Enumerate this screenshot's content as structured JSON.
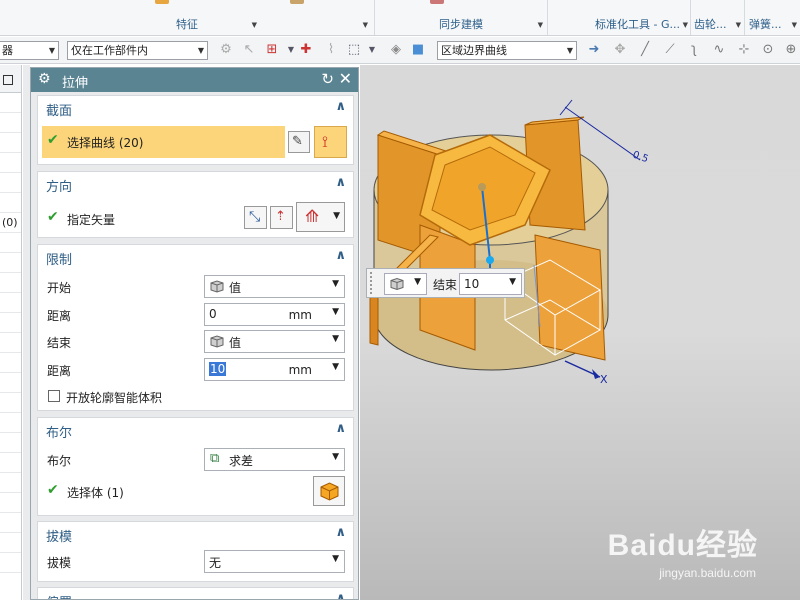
{
  "ribbon": {
    "groups": [
      {
        "label": "特征"
      },
      {
        "label": "同步建模"
      },
      {
        "label": "标准化工具 - G..."
      },
      {
        "label": "齿轮..."
      },
      {
        "label": "弹簧..."
      }
    ]
  },
  "toolbar": {
    "filter_partial": "器",
    "scope_select": "仅在工作部件内",
    "curve_rule_select": "区域边界曲线"
  },
  "navigator": {
    "count_text": "(0)"
  },
  "dialog": {
    "title": "拉伸",
    "sections": {
      "section": {
        "title": "截面",
        "select_curve": "选择曲线 (20)"
      },
      "direction": {
        "title": "方向",
        "specify_vector": "指定矢量"
      },
      "limits": {
        "title": "限制",
        "start_label": "开始",
        "start_value": "值",
        "start_distance_label": "距离",
        "start_distance": "0",
        "start_unit": "mm",
        "end_label": "结束",
        "end_value": "值",
        "end_distance_label": "距离",
        "end_distance": "10",
        "end_unit": "mm",
        "open_profile": "开放轮廓智能体积"
      },
      "boolean": {
        "title": "布尔",
        "boolean_label": "布尔",
        "boolean_value": "求差",
        "select_body": "选择体 (1)"
      },
      "draft": {
        "title": "拔模",
        "draft_label": "拔模",
        "draft_value": "无"
      },
      "offset": {
        "title": "偏置"
      }
    }
  },
  "viewport": {
    "dyn_label": "结束",
    "dyn_value": "10",
    "dim_label": "0.5",
    "axis_label": "X"
  },
  "watermark": {
    "brand": "Baidu经验",
    "url": "jingyan.baidu.com"
  },
  "colors": {
    "title_bar": "#5b8493",
    "section_title": "#2f5e86",
    "highlight_row": "#fcd57a",
    "solid_orange": "#f5a623"
  }
}
